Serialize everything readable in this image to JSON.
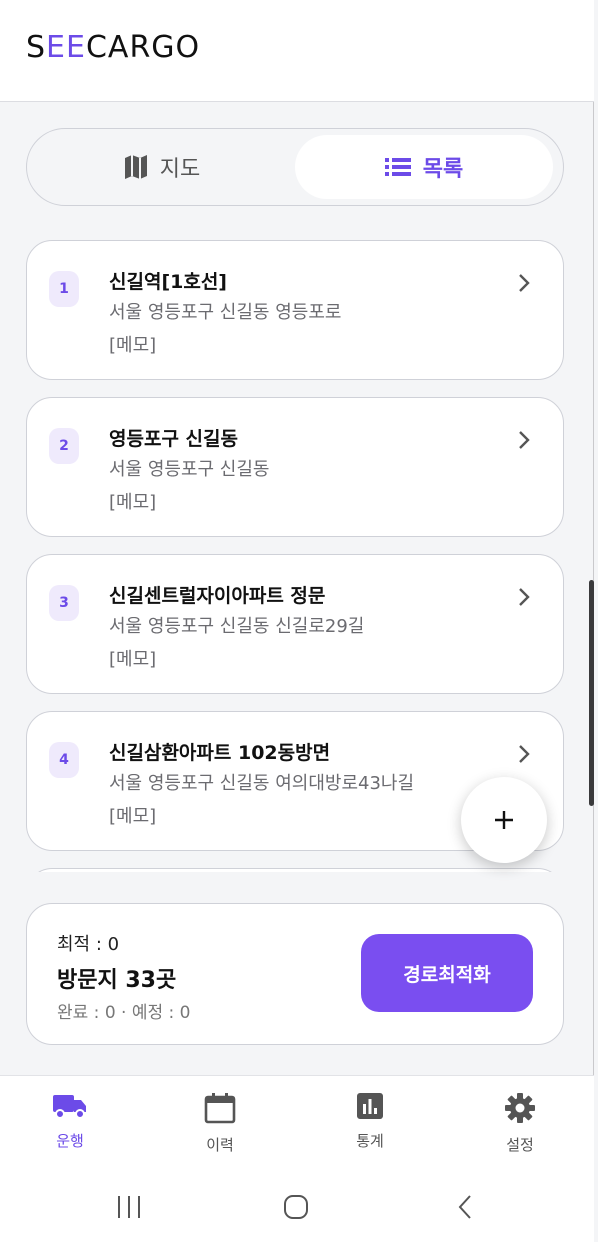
{
  "app": {
    "logo_prefix": "S",
    "logo_accent": "EE",
    "logo_suffix": "CARGO"
  },
  "view_toggle": {
    "map_label": "지도",
    "list_label": "목록",
    "selected": "목록"
  },
  "stops": [
    {
      "num": "1",
      "title": "신길역[1호선]",
      "address": "서울 영등포구 신길동 영등포로",
      "memo": "[메모]"
    },
    {
      "num": "2",
      "title": "영등포구 신길동",
      "address": "서울 영등포구 신길동",
      "memo": "[메모]"
    },
    {
      "num": "3",
      "title": "신길센트럴자이아파트 정문",
      "address": "서울 영등포구 신길동 신길로29길",
      "memo": "[메모]"
    },
    {
      "num": "4",
      "title": "신길삼환아파트 102동방면",
      "address": "서울 영등포구 신길동 여의대방로43나길",
      "memo": "[메모]"
    }
  ],
  "summary": {
    "optimal": "최적 : 0",
    "visits": "방문지 33곳",
    "status": "완료 : 0 · 예정 : 0",
    "optimize_button": "경로최적화"
  },
  "bottom_nav": [
    {
      "label": "운행",
      "icon": "truck-icon",
      "active": true
    },
    {
      "label": "이력",
      "icon": "calendar-icon",
      "active": false
    },
    {
      "label": "통계",
      "icon": "bar-chart-icon",
      "active": false
    },
    {
      "label": "설정",
      "icon": "gear-icon",
      "active": false
    }
  ],
  "colors": {
    "accent": "#6c4be8",
    "button": "#7a4ef0",
    "badge_bg": "#efeafc"
  }
}
